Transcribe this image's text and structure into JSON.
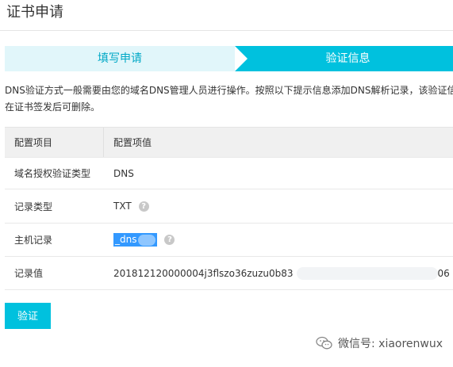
{
  "page": {
    "title": "证书申请"
  },
  "steps": [
    {
      "label": "填写申请",
      "state": "done"
    },
    {
      "label": "验证信息",
      "state": "active"
    }
  ],
  "description": {
    "line1": "DNS验证方式一般需要由您的域名DNS管理人员进行操作。按照以下提示信息添加DNS解析记录，该验证信",
    "line2": "在证书签发后可删除。"
  },
  "table": {
    "headers": [
      "配置项目",
      "配置项值"
    ],
    "rows": [
      {
        "item": "域名授权验证类型",
        "value": "DNS"
      },
      {
        "item": "记录类型",
        "value": "TXT"
      },
      {
        "item": "主机记录",
        "value": "_dns"
      },
      {
        "item": "记录值",
        "value_start": "201812120000004j3flszo36zuzu0b83",
        "value_end": "06"
      }
    ]
  },
  "actions": {
    "verify_label": "验证"
  },
  "watermark": {
    "text": "微信号: xiaorenwux"
  },
  "colors": {
    "accent": "#00c1de",
    "step_done_bg": "#e1f6fa",
    "step_done_text": "#00a8c6",
    "header_bg": "#f0f0f0"
  }
}
